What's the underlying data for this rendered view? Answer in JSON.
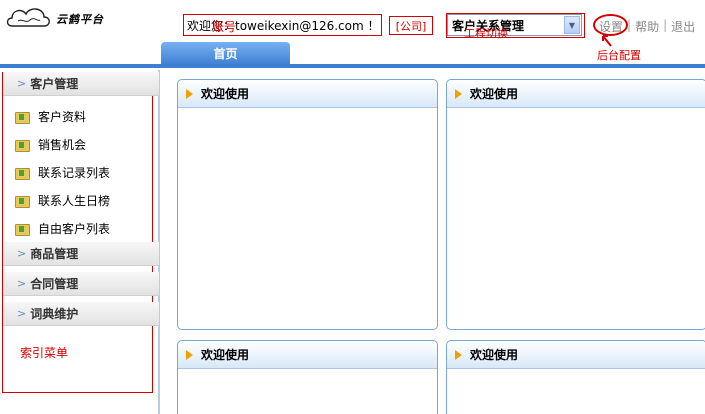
{
  "header": {
    "logo_text": "云鹤平台",
    "account": "欢迎您：toweikexin@126.com ！",
    "account_note": "账号",
    "company": "[公司]",
    "project_select": "客户关系管理",
    "project_note": "工程切换",
    "links": [
      "设置",
      "帮助",
      "退出"
    ],
    "settings_note": "后台配置"
  },
  "tabs": [
    {
      "label": "首页"
    }
  ],
  "sidebar": {
    "groups": [
      {
        "label": "客户管理"
      },
      {
        "label": "商品管理"
      },
      {
        "label": "合同管理"
      },
      {
        "label": "词典维护"
      }
    ],
    "items": [
      {
        "label": "客户资料"
      },
      {
        "label": "销售机会"
      },
      {
        "label": "联系记录列表"
      },
      {
        "label": "联系人生日榜"
      },
      {
        "label": "自由客户列表"
      }
    ],
    "note": "索引菜单"
  },
  "panels": [
    {
      "title": "欢迎使用"
    },
    {
      "title": "欢迎使用"
    },
    {
      "title": "欢迎使用"
    },
    {
      "title": "欢迎使用"
    }
  ],
  "colors": {
    "accent": "#3f7fd3",
    "annotation": "#d20000",
    "panel_border": "#7aa6d6"
  },
  "icons": [
    "cloud-logo-icon",
    "dropdown-arrow-icon",
    "chevron-right-icon",
    "folder-icon",
    "triangle-icon",
    "annotation-arrow-icon"
  ]
}
